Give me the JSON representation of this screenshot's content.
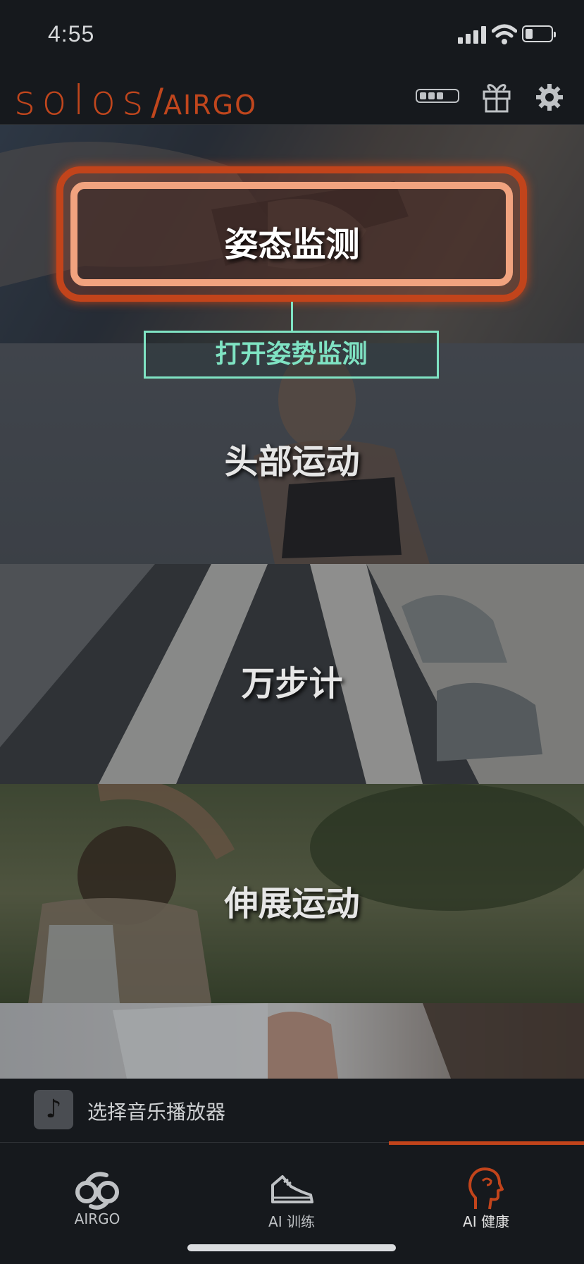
{
  "status_bar": {
    "time": "4:55"
  },
  "header": {
    "brand_primary": "solos",
    "brand_slash": "/",
    "brand_secondary": "AIRGO",
    "brand_color": "#c0461d"
  },
  "panels": [
    {
      "label": "姿态监测",
      "id": "posture"
    },
    {
      "label": "头部运动",
      "id": "head"
    },
    {
      "label": "万步计",
      "id": "pedometer"
    },
    {
      "label": "伸展运动",
      "id": "stretch"
    },
    {
      "label": "",
      "id": "hydration"
    }
  ],
  "tooltip": {
    "text": "打开姿势监测",
    "color": "#7fe3c3"
  },
  "music": {
    "label": "选择音乐播放器",
    "icon": "music-note-icon"
  },
  "tabs": [
    {
      "label": "AIRGO",
      "icon": "airgo-logo-icon",
      "active": false
    },
    {
      "label": "AI 训练",
      "icon": "sneaker-icon",
      "active": false
    },
    {
      "label": "AI 健康",
      "icon": "head-profile-icon",
      "active": true
    }
  ],
  "accent_color": "#c2441b"
}
